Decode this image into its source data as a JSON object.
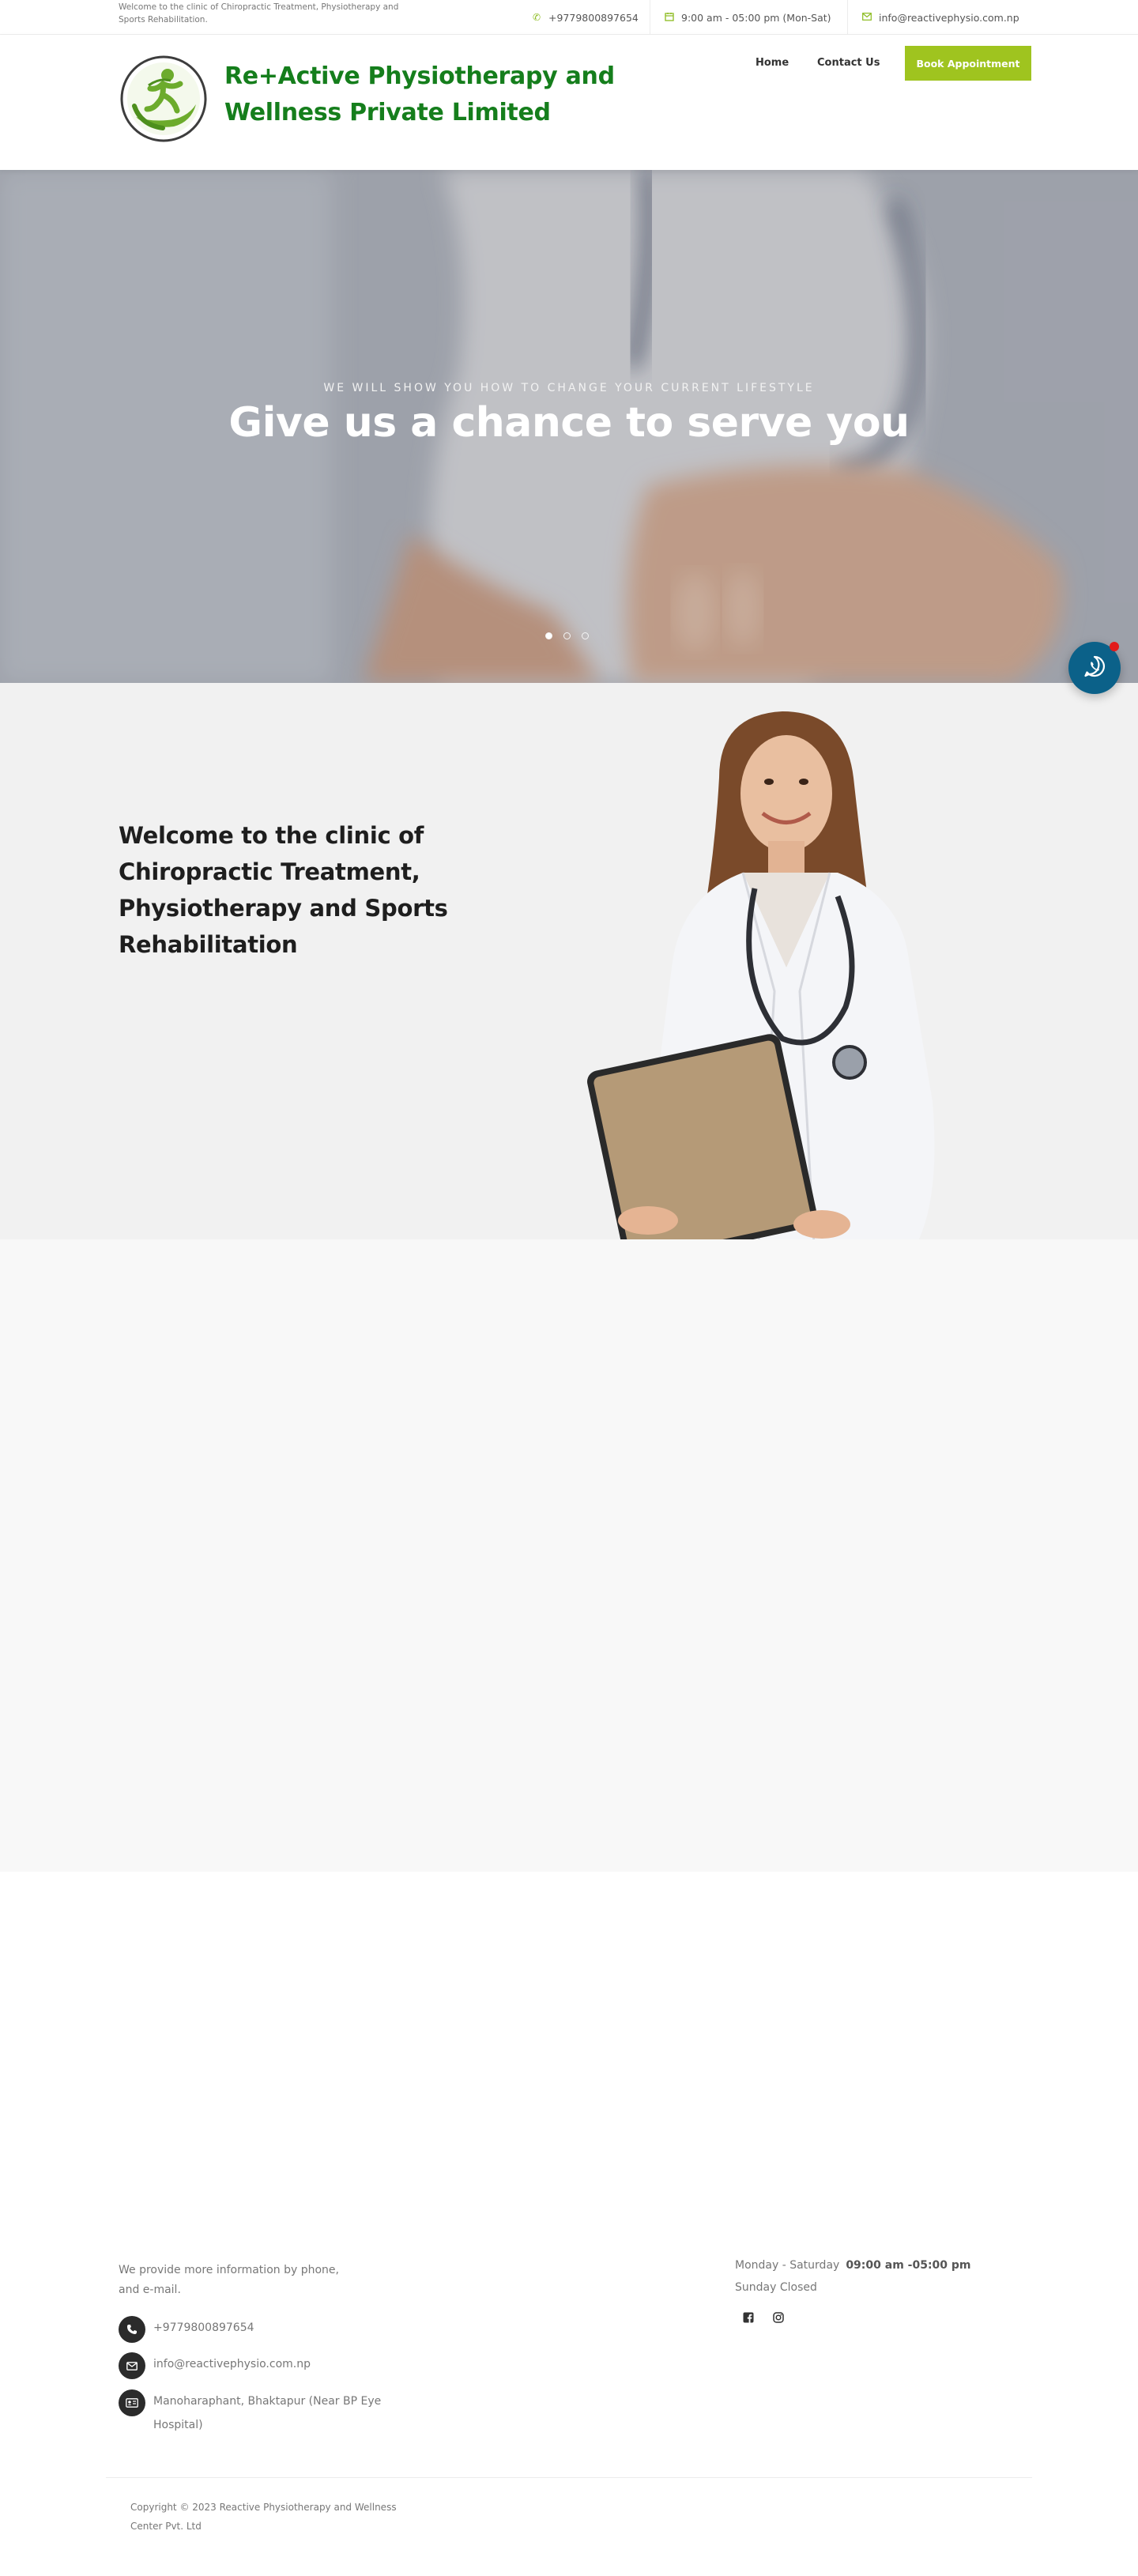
{
  "topbar": {
    "welcome": "Welcome to the clinic of Chiropractic Treatment, Physiotherapy and Sports Rehabilitation.",
    "phone": "+9779800897654",
    "hours": "9:00 am - 05:00 pm (Mon-Sat)",
    "email": "info@reactivephysio.com.np"
  },
  "header": {
    "brand": "Re+Active Physiotherapy and Wellness Private Limited",
    "nav": {
      "home": "Home",
      "contact": "Contact Us"
    },
    "cta": "Book Appointment"
  },
  "hero": {
    "tagline": "WE WILL SHOW YOU HOW TO CHANGE YOUR CURRENT LIFESTYLE",
    "title": "Give us a chance to serve you",
    "slides": 3,
    "active_slide": 1
  },
  "welcome": {
    "title": "Welcome to the clinic of Chiropractic Treatment, Physiotherapy and Sports Rehabilitation"
  },
  "footer": {
    "intro": "We provide more information by phone, and e-mail.",
    "phone": "+9779800897654",
    "email": "info@reactivephysio.com.np",
    "address": "Manoharaphant, Bhaktapur (Near BP Eye Hospital)",
    "days": "Monday - Saturday",
    "hours": "09:00 am -05:00 pm",
    "sunday": "Sunday Closed",
    "copyright": "Copyright © 2023 Reactive Physiotherapy and Wellness Center Pvt. Ltd"
  },
  "colors": {
    "brand_green": "#157e1c",
    "accent_lime": "#9fc41f",
    "whatsapp_blue": "#0b6189",
    "badge_red": "#e21b1b"
  },
  "icons": [
    "phone-icon",
    "calendar-icon",
    "mail-icon",
    "whatsapp-icon",
    "address-card-icon",
    "facebook-icon",
    "instagram-icon"
  ]
}
